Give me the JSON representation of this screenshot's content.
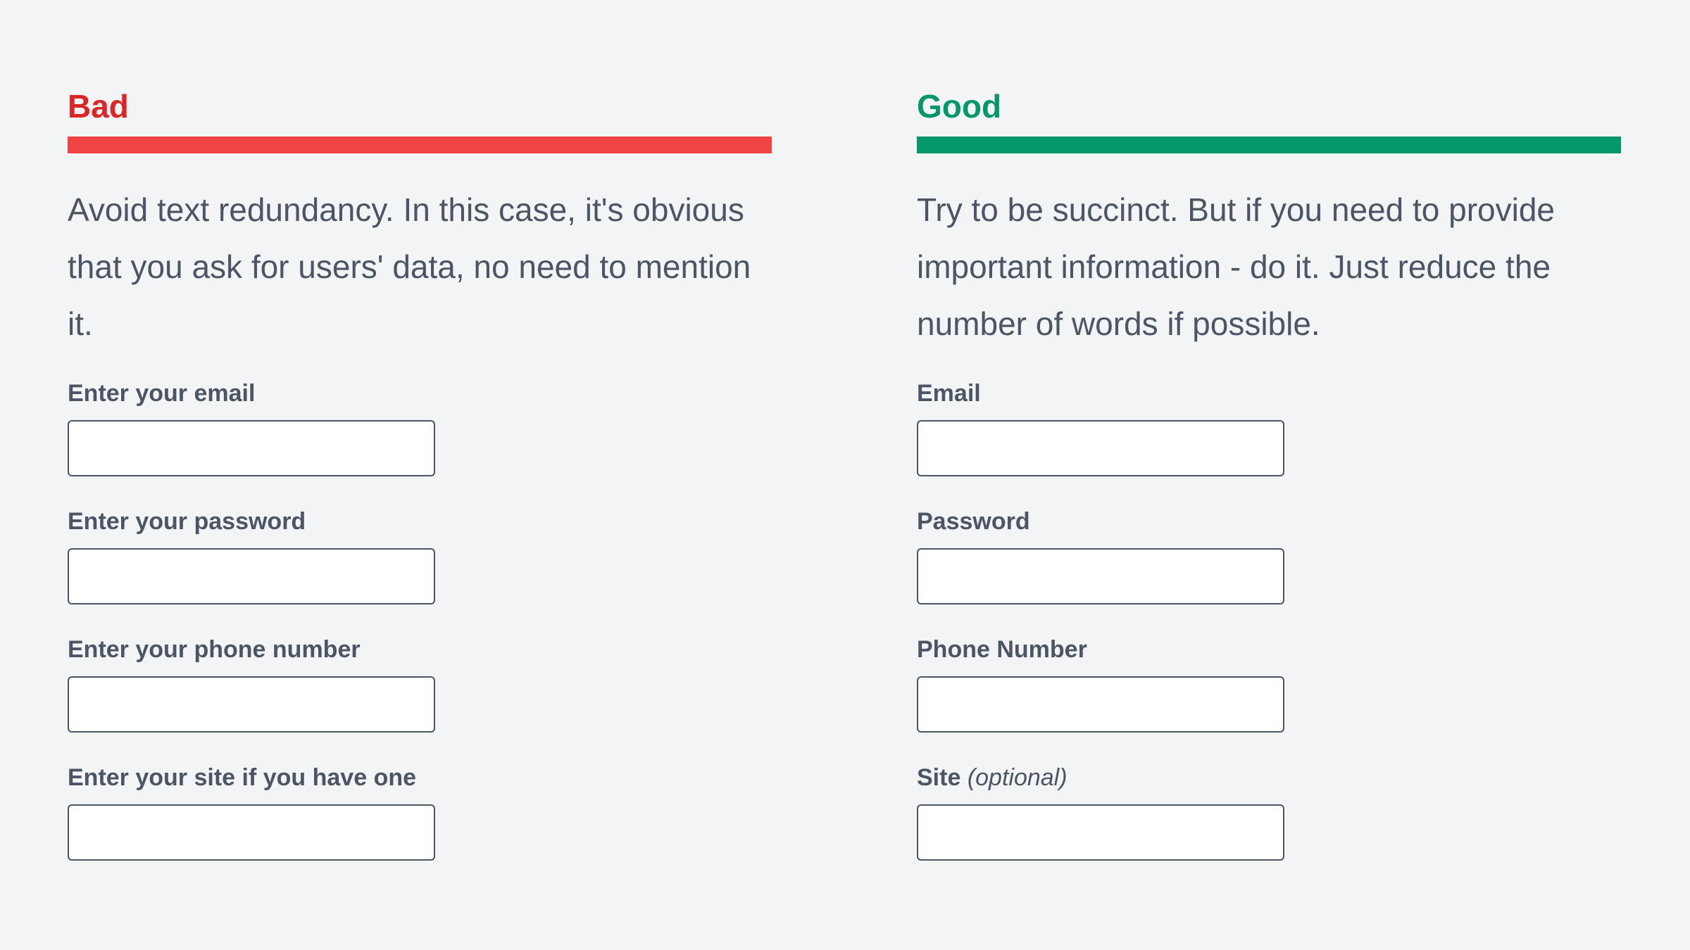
{
  "bad": {
    "title": "Bad",
    "description": "Avoid text redundancy. In this case, it's obvious that you ask for users' data, no need to mention it.",
    "fields": [
      {
        "label": "Enter your email",
        "value": ""
      },
      {
        "label": "Enter your password",
        "value": ""
      },
      {
        "label": "Enter your phone number",
        "value": ""
      },
      {
        "label": "Enter your site if you have one",
        "value": ""
      }
    ]
  },
  "good": {
    "title": "Good",
    "description": "Try to be succinct. But if you need to provide important information - do it. Just reduce the number of words if possible.",
    "fields": [
      {
        "label": "Email",
        "value": ""
      },
      {
        "label": "Password",
        "value": ""
      },
      {
        "label": "Phone Number",
        "value": ""
      },
      {
        "label": "Site",
        "optional_note": "(optional)",
        "value": ""
      }
    ]
  },
  "colors": {
    "bad_accent": "#ef4444",
    "bad_title": "#dc2626",
    "good_accent": "#059669",
    "text": "#4b5563",
    "background": "#f3f4f6"
  }
}
